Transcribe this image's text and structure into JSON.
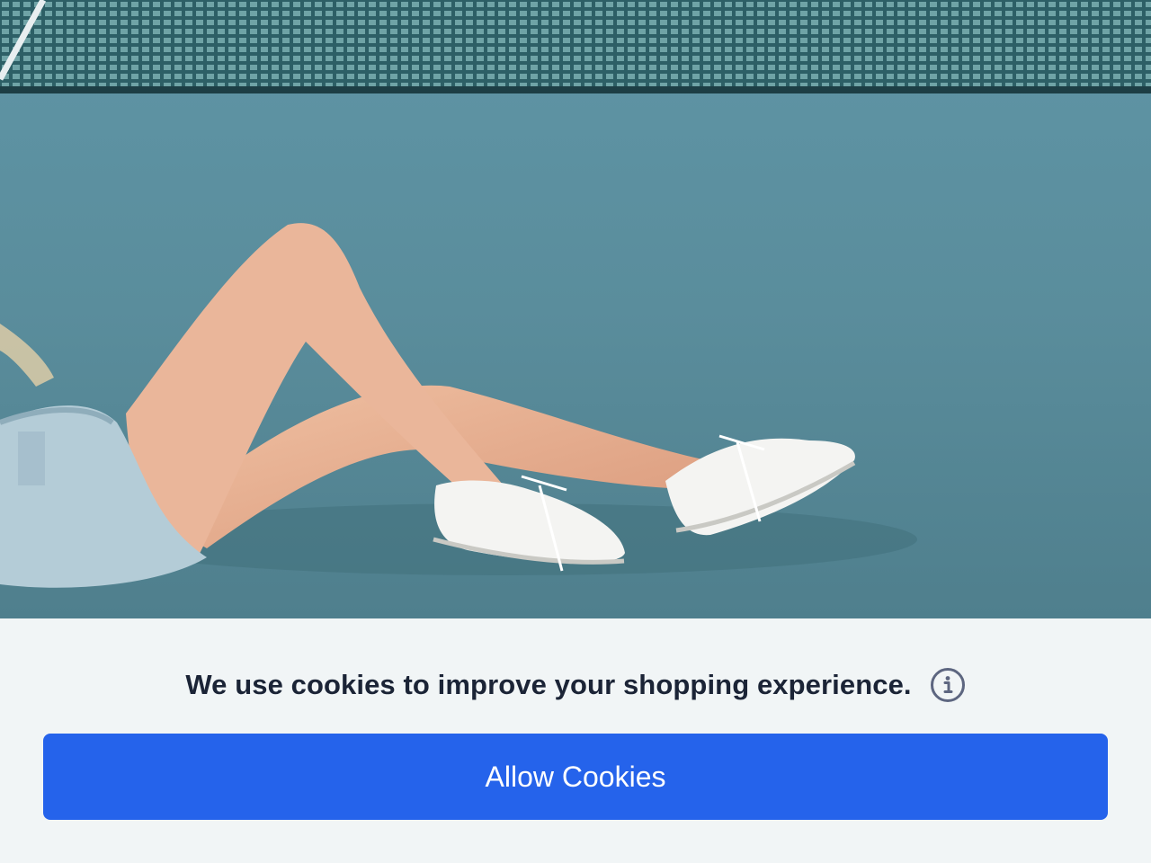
{
  "hero": {
    "image": "tennis-court-sneakers-photo"
  },
  "cookie_banner": {
    "message": "We use cookies to improve your shopping experience.",
    "info_icon": "info-circle-icon",
    "allow_label": "Allow Cookies"
  },
  "colors": {
    "accent": "#2563eb",
    "banner_background": "#f1f5f6",
    "text": "#1b2436",
    "icon": "#5d6680"
  }
}
